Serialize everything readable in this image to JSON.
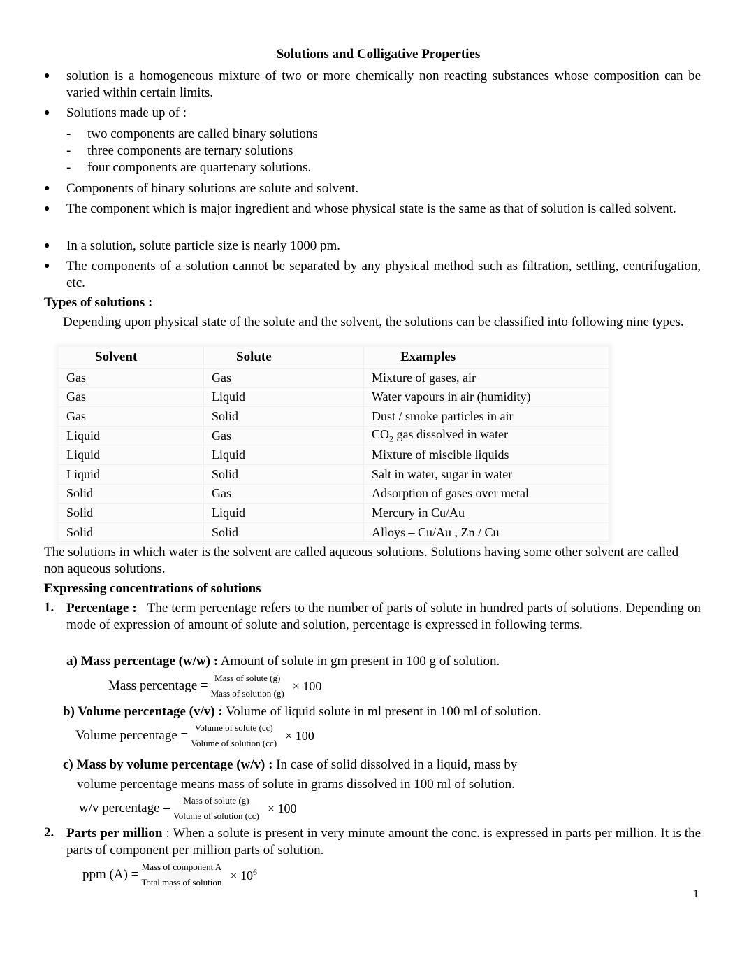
{
  "title": "Solutions and Colligative Properties",
  "bullets": [
    "solution is a homogeneous mixture of two or more chemically non reacting substances whose composition can be varied within certain limits.",
    "Solutions made up of :",
    "Components of binary solutions are solute and solvent.",
    "The component which is major ingredient and whose physical state is the same as that of solution is called solvent.",
    "In a solution, solute particle size is nearly 1000 pm.",
    "The components of a solution cannot be separated by any physical method such as filtration, settling, centrifugation, etc."
  ],
  "sub_items": [
    "two components are called binary solutions",
    "three components are ternary solutions",
    "four components are quartenary solutions."
  ],
  "types": {
    "heading": "Types of solutions :",
    "intro": "Depending upon physical state of the solute and the solvent, the solutions can be classified into following nine types.",
    "table": {
      "headers": [
        "Solvent",
        "Solute",
        "Examples"
      ],
      "rows": [
        [
          "Gas",
          "Gas",
          "Mixture of gases, air"
        ],
        [
          "Gas",
          "Liquid",
          "Water vapours in air (humidity)"
        ],
        [
          "Gas",
          "Solid",
          "Dust / smoke particles in air"
        ],
        [
          "Liquid",
          "Gas",
          "CO",
          "2",
          " gas dissolved in water"
        ],
        [
          "Liquid",
          "Liquid",
          "Mixture of miscible liquids"
        ],
        [
          "Liquid",
          "Solid",
          "Salt in water, sugar in water"
        ],
        [
          "Solid",
          "Gas",
          "Adsorption  of gases over metal"
        ],
        [
          "Solid",
          "Liquid",
          "Mercury in Cu/Au"
        ],
        [
          "Solid",
          "Solid",
          "Alloys – Cu/Au ,  Zn / Cu"
        ]
      ]
    },
    "after": "The solutions in which water is the solvent are called aqueous solutions. Solutions having some other solvent are called non aqueous solutions."
  },
  "concentration": {
    "heading": "Expressing concentrations of solutions",
    "item1": {
      "num": "1.",
      "label": "Percentage :",
      "text": "The term percentage refers to the number of parts of solute in hundred parts of solutions.    Depending on mode of expression of amount of solute and solution, percentage is expressed in following terms.",
      "a": {
        "label": "a)  Mass percentage (w/w) :",
        "text": " Amount of solute in gm present in 100 g of solution.",
        "lhs": "Mass percentage =",
        "num": "Mass  of  solute (g)",
        "den": "Mass  of  solution (g)",
        "rhs": "×  100"
      },
      "b": {
        "label": "b)  Volume percentage (v/v) :",
        "text": " Volume of liquid solute in ml present in 100 ml of solution.",
        "lhs": "Volume percentage  =",
        "num": "Volume  of  solute (cc)",
        "den": "Volume of  solution (cc)",
        "rhs": "×  100"
      },
      "c": {
        "label": "c)  Mass by volume percentage (w/v) :",
        "text": " In case of solid dissolved in a liquid, mass by",
        "text2": "volume percentage means mass of solute in grams dissolved in 100 ml of solution.",
        "lhs": "w/v percentage   =",
        "num": "Mass  of  solute (g)",
        "den": "Volume of solution (cc)",
        "rhs": "×  100"
      }
    },
    "item2": {
      "num": "2.",
      "label": "Parts per million",
      "text": " : When a solute is present in very  minute amount  the conc. is expressed in parts per  million. It is the parts of component per  million parts of solution.",
      "lhs": "ppm (A)   =",
      "num_text": "Mass  of  component A",
      "den": "Total mass of solution",
      "rhs": "×  10",
      "exp": "6"
    }
  },
  "page_number": "1"
}
